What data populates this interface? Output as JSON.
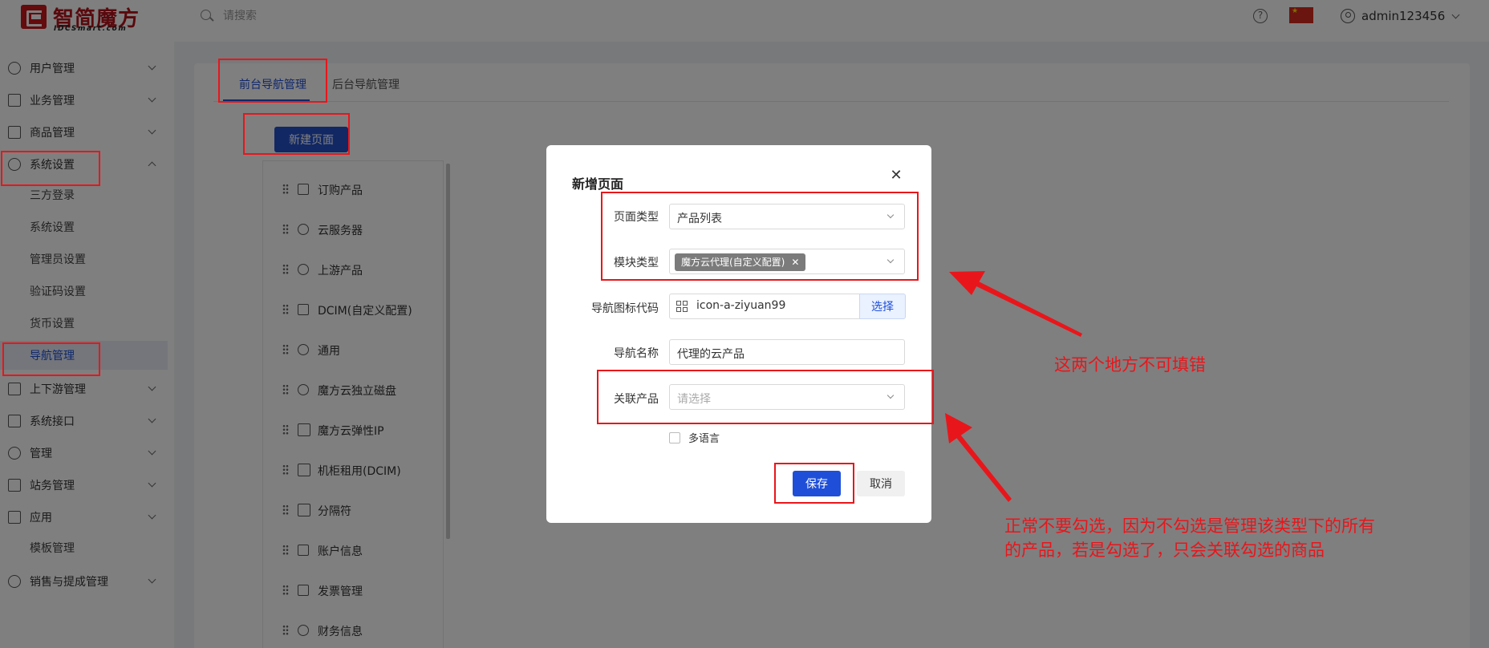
{
  "header": {
    "logo_text": "智简魔方",
    "logo_sub": "IDCSmart.com",
    "search_placeholder": "请搜索",
    "user_name": "admin123456"
  },
  "sidebar": {
    "items": [
      {
        "label": "用户管理",
        "icon": "user-icon"
      },
      {
        "label": "业务管理",
        "icon": "document-icon"
      },
      {
        "label": "商品管理",
        "icon": "cart-icon"
      },
      {
        "label": "系统设置",
        "icon": "settings-icon"
      },
      {
        "label": "上下游管理",
        "icon": "filter-icon"
      },
      {
        "label": "系统接口",
        "icon": "folder-icon"
      },
      {
        "label": "管理",
        "icon": "tools-icon"
      },
      {
        "label": "站务管理",
        "icon": "site-icon"
      },
      {
        "label": "应用",
        "icon": "cube-icon"
      },
      {
        "label": "销售与提成管理",
        "icon": "wrench-icon"
      }
    ],
    "system_sub": [
      "三方登录",
      "系统设置",
      "管理员设置",
      "验证码设置",
      "货币设置",
      "导航管理"
    ],
    "app_sub": [
      "模板管理"
    ]
  },
  "main": {
    "tabs": [
      "前台导航管理",
      "后台导航管理"
    ],
    "new_button": "新建页面",
    "nav_items": [
      "订购产品",
      "云服务器",
      "上游产品",
      "DCIM(自定义配置)",
      "通用",
      "魔方云独立磁盘",
      "魔方云弹性IP",
      "机柜租用(DCIM)",
      "分隔符",
      "账户信息",
      "发票管理",
      "财务信息"
    ]
  },
  "modal": {
    "title": "新增页面",
    "labels": {
      "page_type": "页面类型",
      "module_type": "模块类型",
      "nav_icon": "导航图标代码",
      "nav_name": "导航名称",
      "related_product": "关联产品"
    },
    "page_type_value": "产品列表",
    "module_type_tag": "魔方云代理(自定义配置)",
    "nav_icon_value": "icon-a-ziyuan99",
    "pick_button": "选择",
    "nav_name_value": "代理的云产品",
    "related_product_placeholder": "请选择",
    "multi_lang_label": "多语言",
    "save_button": "保存",
    "cancel_button": "取消"
  },
  "annotations": {
    "note1": "这两个地方不可填错",
    "note2_line1": "正常不要勾选，因为不勾选是管理该类型下的所有",
    "note2_line2": "的产品，若是勾选了，只会关联勾选的商品",
    "color": "#e8161b"
  },
  "colors": {
    "primary": "#1f4fd8",
    "brand": "#c8161d"
  }
}
